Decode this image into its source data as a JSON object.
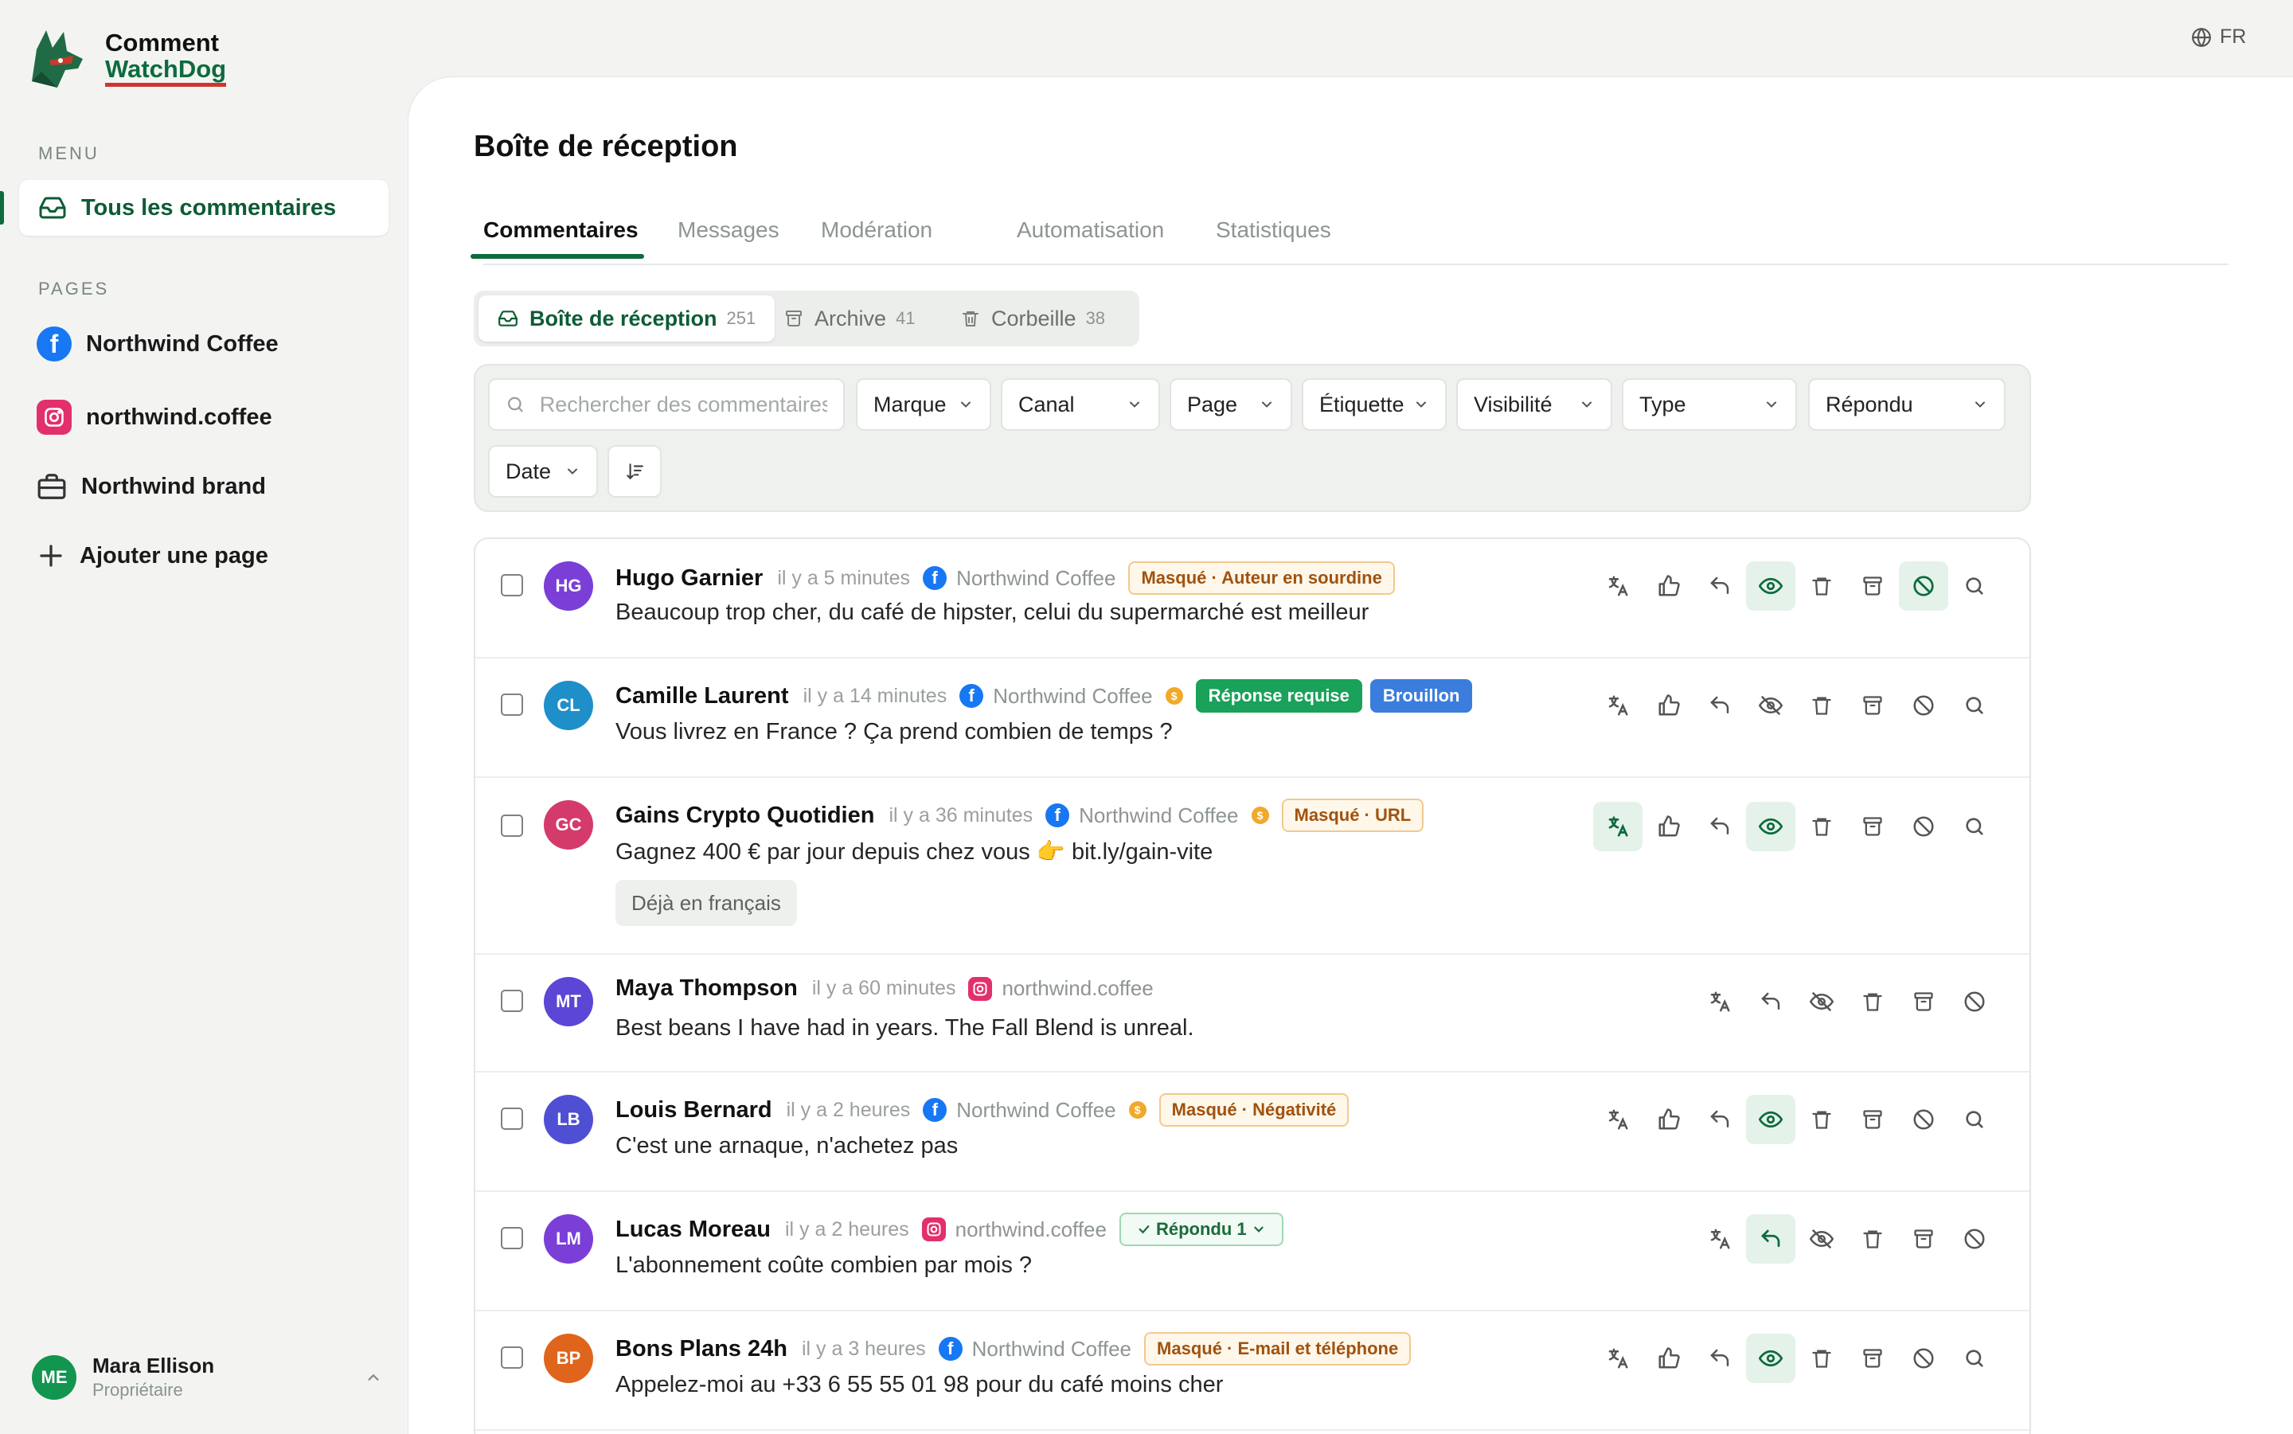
{
  "app": {
    "name_line1": "Comment",
    "name_line2": "WatchDog"
  },
  "language": "FR",
  "sidebar": {
    "menu_label": "MENU",
    "all_comments": "Tous les commentaires",
    "pages_label": "PAGES",
    "pages": [
      {
        "label": "Northwind Coffee",
        "icon": "facebook-icon"
      },
      {
        "label": "northwind.coffee",
        "icon": "instagram-icon"
      },
      {
        "label": "Northwind brand",
        "icon": "briefcase-icon"
      }
    ],
    "add_page": "Ajouter une page",
    "user": {
      "initials": "ME",
      "name": "Mara Ellison",
      "role": "Propriétaire"
    }
  },
  "main": {
    "title": "Boîte de réception",
    "tabs": [
      "Commentaires",
      "Messages",
      "Modération",
      "Automatisation",
      "Statistiques"
    ],
    "folders": [
      {
        "label": "Boîte de réception",
        "count": "251"
      },
      {
        "label": "Archive",
        "count": "41"
      },
      {
        "label": "Corbeille",
        "count": "38"
      }
    ],
    "filters": {
      "search_placeholder": "Rechercher des commentaires...",
      "brand": "Marque",
      "channel": "Canal",
      "page": "Page",
      "label": "Étiquette",
      "visibility": "Visibilité",
      "type": "Type",
      "answered": "Répondu",
      "date": "Date"
    },
    "comments": [
      {
        "initials": "HG",
        "author": "Hugo Garnier",
        "time": "il y a 5 minutes",
        "source": "Northwind Coffee",
        "text": "Beaucoup trop cher, du café de hipster, celui du supermarché est meilleur",
        "tag": "Masqué · Auteur en sourdine"
      },
      {
        "initials": "CL",
        "author": "Camille Laurent",
        "time": "il y a 14 minutes",
        "source": "Northwind Coffee",
        "text": "Vous livrez en France ? Ça prend combien de temps ?",
        "tag": "Réponse requise",
        "tag2": "Brouillon"
      },
      {
        "initials": "GC",
        "author": "Gains Crypto Quotidien",
        "time": "il y a 36 minutes",
        "source": "Northwind Coffee",
        "text": "Gagnez 400 € par jour depuis chez vous 👉 bit.ly/gain-vite",
        "tag": "Masqué · URL",
        "chip": "Déjà en français"
      },
      {
        "initials": "MT",
        "author": "Maya Thompson",
        "time": "il y a 60 minutes",
        "source": "northwind.coffee",
        "text": "Best beans I have had in years. The Fall Blend is unreal."
      },
      {
        "initials": "LB",
        "author": "Louis Bernard",
        "time": "il y a 2 heures",
        "source": "Northwind Coffee",
        "text": "C'est une arnaque, n'achetez pas",
        "tag": "Masqué · Négativité"
      },
      {
        "initials": "LM",
        "author": "Lucas Moreau",
        "time": "il y a 2 heures",
        "source": "northwind.coffee",
        "text": "L'abonnement coûte combien par mois ?",
        "tag": "Répondu 1"
      },
      {
        "initials": "BP",
        "author": "Bons Plans 24h",
        "time": "il y a 3 heures",
        "source": "Northwind Coffee",
        "text": "Appelez-moi au +33 6 55 55 01 98 pour du café moins cher",
        "tag": "Masqué · E-mail et téléphone"
      }
    ]
  },
  "colors": {
    "brand_green": "#0d6b3e",
    "accent_red": "#d0362f",
    "facebook": "#1877f2",
    "instagram": "#e1306c"
  }
}
